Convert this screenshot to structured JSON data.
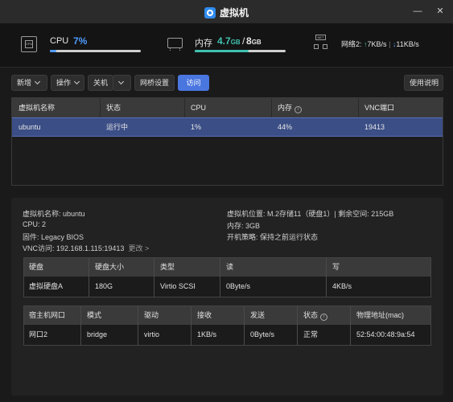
{
  "window": {
    "title": "虚拟机",
    "minimize": "—",
    "close": "✕"
  },
  "stats": {
    "cpu": {
      "label": "CPU",
      "value": "7%",
      "percent": 7,
      "icon": "cpu-icon",
      "icon_text": "CPU"
    },
    "memory": {
      "label": "内存",
      "used": "4.7",
      "used_unit": "GB",
      "sep": "/",
      "total": "8",
      "total_unit": "GB",
      "percent": 59,
      "icon": "memory-icon",
      "icon_text": "RAM"
    },
    "network": {
      "label": "网络2:",
      "up_arrow": "↑",
      "up": "7KB/s",
      "divider": "|",
      "down_arrow": "↓",
      "down": "11KB/s",
      "icon": "network-icon",
      "icon_text": "NET"
    }
  },
  "colors": {
    "accent": "#4a76e0",
    "cpu": "#4f9cff",
    "memory": "#3fc1b0",
    "selected_row": "#3b4e86"
  },
  "toolbar": {
    "new": "新增",
    "actions": "操作",
    "shutdown": "关机",
    "bridge": "网桥设置",
    "visit": "访问",
    "help": "使用说明"
  },
  "vm_table": {
    "columns": [
      "虚拟机名称",
      "状态",
      "CPU",
      "内存",
      "VNC端口"
    ],
    "memory_info_icon": "i",
    "rows": [
      {
        "name": "ubuntu",
        "status": "运行中",
        "cpu": "1%",
        "memory": "44%",
        "vnc": "19413"
      }
    ]
  },
  "detail": {
    "name": "虚拟机名称: ubuntu",
    "cpu": "CPU: 2",
    "firmware": "固件: Legacy BIOS",
    "vnc": "VNC访问: 192.168.1.115:19413",
    "vnc_more": "更改 >",
    "location": "虚拟机位置: M.2存储11（硬盘1）| 剩余空间: 215GB",
    "memory": "内存: 3GB",
    "boot": "开机策略: 保持之前运行状态"
  },
  "disk_table": {
    "columns": [
      "硬盘",
      "硬盘大小",
      "类型",
      "读",
      "写"
    ],
    "rows": [
      {
        "disk": "虚拟硬盘A",
        "size": "180G",
        "type": "Virtio SCSI",
        "read": "0Byte/s",
        "write": "4KB/s"
      }
    ]
  },
  "nic_table": {
    "columns": [
      "宿主机网口",
      "模式",
      "驱动",
      "接收",
      "发送",
      "状态",
      "物理地址(mac)"
    ],
    "status_info_icon": "i",
    "rows": [
      {
        "port": "网口2",
        "mode": "bridge",
        "driver": "virtio",
        "rx": "1KB/s",
        "tx": "0Byte/s",
        "status": "正常",
        "mac": "52:54:00:48:9a:54"
      }
    ]
  }
}
